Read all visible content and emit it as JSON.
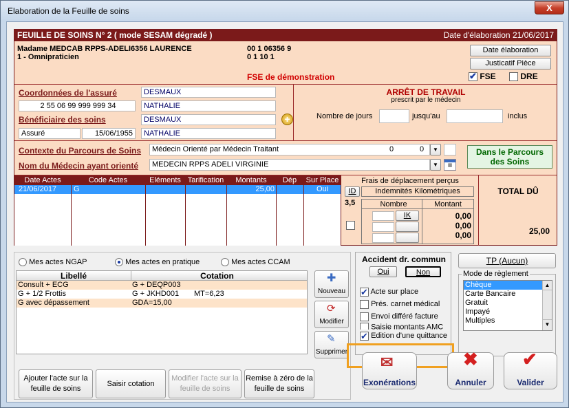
{
  "window": {
    "title": "Elaboration de la Feuille de soins",
    "close_label": "X"
  },
  "fse": {
    "header_left": "FEUILLE DE SOINS  N° 2 ( mode SESAM dégradé )",
    "header_right": "Date d'élaboration 21/06/2017",
    "doctor_name": "Madame MEDCAB RPPS-ADELI6356 LAURENCE",
    "doctor_specialty": "1 - Omnipraticien",
    "doctor_id1": "00 1 06356 9",
    "doctor_id2": "0 1 10 1",
    "demo_label": "FSE de démonstration",
    "btn_date": "Date élaboration",
    "btn_justif": "Justicatif Pièce",
    "fse_check": "FSE",
    "dre_check": "DRE"
  },
  "assure": {
    "coord_label": "Coordonnées de l'assuré",
    "nom": "DESMAUX",
    "num": "2 55 06 99 999 999 34",
    "prenom": "NATHALIE",
    "benef_label": "Bénéficiaire des soins",
    "benef_nom": "DESMAUX",
    "qualite": "Assuré",
    "naissance": "15/06/1955",
    "benef_prenom": "NATHALIE"
  },
  "arret": {
    "title": "ARRÊT DE TRAVAIL",
    "subtitle": "prescrit par le médecin",
    "nb_jours_label": "Nombre de jours",
    "jusquau_label": "jusqu'au",
    "inclus_label": "inclus"
  },
  "parcours": {
    "contexte_label": "Contexte du Parcours de Soins",
    "contexte_value": "Médecin Orienté par Médecin Traitant",
    "contexte_n1": "0",
    "contexte_n2": "0",
    "medecin_label": "Nom du Médecin ayant orienté",
    "medecin_value": "MEDECIN RPPS ADELI   VIRGINIE",
    "dans_parcours": "Dans le Parcours des Soins"
  },
  "actes_table": {
    "headers": [
      "Date Actes",
      "Code Actes",
      "Eléments",
      "Tarification",
      "Montants",
      "Dép",
      "Sur Place"
    ],
    "row": {
      "date": "21/06/2017",
      "code": "G",
      "montant": "25,00",
      "sur_place": "Oui"
    }
  },
  "frais": {
    "title": "Frais de déplacement perçus",
    "id_label": "ID",
    "ik_header": "Indemnités Kilométriques",
    "coef": "3,5",
    "nombre_label": "Nombre",
    "montant_label": "Montant",
    "ik_label": "IK",
    "m1": "0,00",
    "m2": "0,00",
    "m3": "0,00"
  },
  "total": {
    "label": "TOTAL DÛ",
    "value": "25,00"
  },
  "actes_list": {
    "radio1": "Mes actes NGAP",
    "radio2": "Mes actes en pratique",
    "radio3": "Mes actes CCAM",
    "col_libelle": "Libellé",
    "col_cotation": "Cotation",
    "rows": [
      {
        "libelle": "Consult + ECG",
        "cotation": "G + DEQP003",
        "extra": ""
      },
      {
        "libelle": "G + 1/2 Frottis",
        "cotation": "G + JKHD001",
        "extra": "MT=6,23"
      },
      {
        "libelle": "G avec dépassement",
        "cotation": "GDA=15,00",
        "extra": ""
      }
    ],
    "btn_nouveau": "Nouveau",
    "btn_modifier": "Modifier",
    "btn_supprimer": "Supprimer"
  },
  "bottom_buttons": {
    "ajouter": "Ajouter l'acte sur la feuille de soins",
    "saisir": "Saisir cotation",
    "modifier": "Modifier l'acte sur la feuille de soins",
    "remise": "Remise à zéro de la feuille de soins"
  },
  "accident": {
    "title": "Accident dr. commun",
    "oui": "Oui",
    "non": "Non",
    "opts": [
      "Acte sur place",
      "Prés. carnet médical",
      "Envoi différé facture",
      "Saisie montants AMC",
      "Edition d'une quittance"
    ]
  },
  "reglement": {
    "tp_button": "TP (Aucun)",
    "legend": "Mode de règlement",
    "options": [
      "Chèque",
      "Carte Bancaire",
      "Gratuit",
      "Impayé",
      "Multiples"
    ]
  },
  "actions": {
    "exonerations": "Exonérations",
    "annuler": "Annuler",
    "valider": "Valider"
  }
}
